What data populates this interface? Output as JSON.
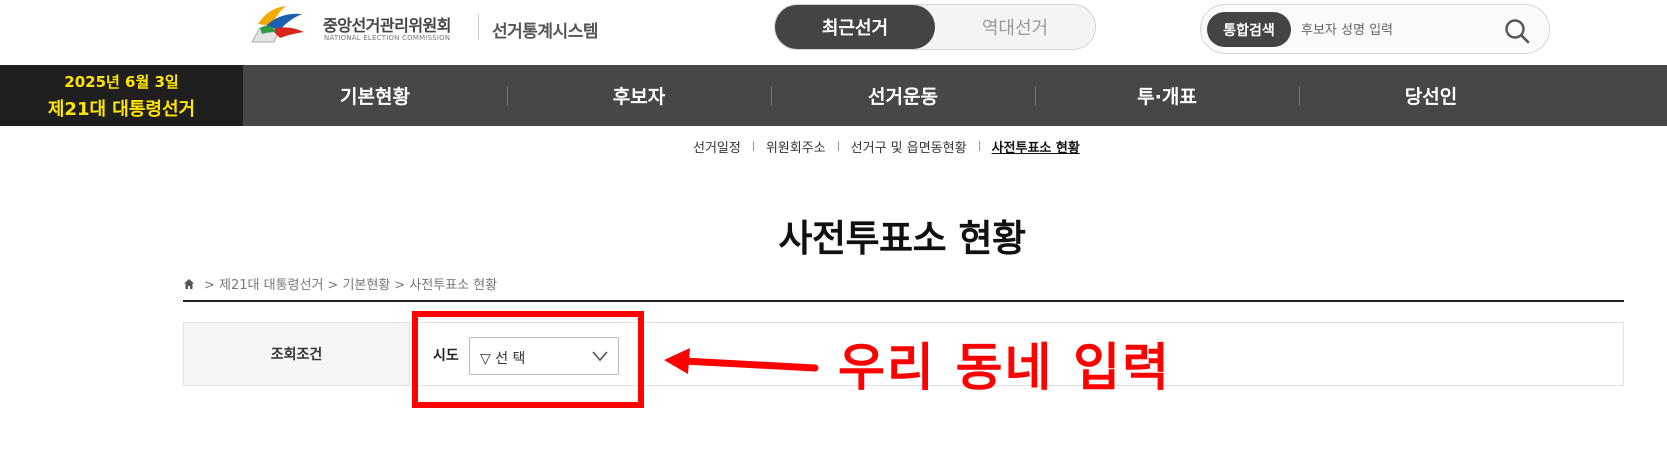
{
  "header": {
    "org_name": "중앙선거관리위원회",
    "org_sub": "NATIONAL ELECTION COMMISSION",
    "system_name": "선거통계시스템",
    "toggle": {
      "active": "최근선거",
      "inactive": "역대선거"
    },
    "search": {
      "badge": "통합검색",
      "placeholder": "후보자 성명 입력",
      "icon": "search-icon"
    }
  },
  "election_badge": {
    "date": "2025년 6월 3일",
    "name": "제21대 대통령선거"
  },
  "nav": {
    "items": [
      {
        "label": "기본현황"
      },
      {
        "label": "후보자"
      },
      {
        "label": "선거운동"
      },
      {
        "label": "투·개표"
      },
      {
        "label": "당선인"
      }
    ]
  },
  "subtabs": {
    "items": [
      {
        "label": "선거일정"
      },
      {
        "label": "위원회주소"
      },
      {
        "label": "선거구 및 읍면동현황"
      },
      {
        "label": "사전투표소 현황"
      }
    ],
    "active": "사전투표소 현황"
  },
  "page": {
    "title": "사전투표소 현황"
  },
  "breadcrumb": {
    "home_icon": "home-icon",
    "items": [
      "> 제21대 대통령선거",
      "> 기본현황",
      "> 사전투표소 현황"
    ]
  },
  "query": {
    "section_label": "조회조건",
    "field_label": "시도",
    "select_value": "▽ 선 택"
  },
  "annotation": {
    "text": "우리 동네 입력",
    "color": "#ff0000"
  },
  "colors": {
    "nav_bg": "#474747",
    "badge_bg": "#1f1f1f",
    "badge_text": "#ffe600",
    "toggle_active": "#444444"
  }
}
